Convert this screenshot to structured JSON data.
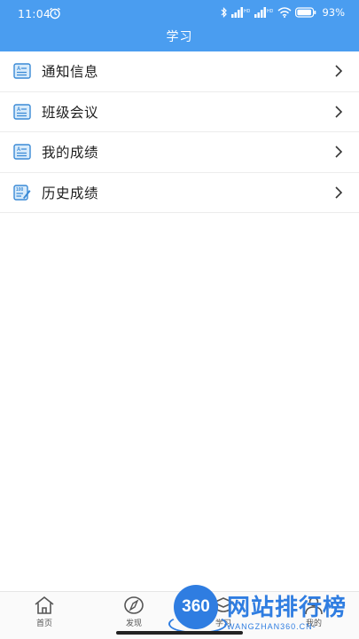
{
  "status_bar": {
    "time": "11:04",
    "battery": "93%"
  },
  "header": {
    "title": "学习"
  },
  "menu": {
    "items": [
      {
        "label": "通知信息",
        "icon": "notice-doc-icon"
      },
      {
        "label": "班级会议",
        "icon": "meeting-doc-icon"
      },
      {
        "label": "我的成绩",
        "icon": "score-doc-icon"
      },
      {
        "label": "历史成绩",
        "icon": "history-score-icon"
      }
    ]
  },
  "tabbar": {
    "items": [
      {
        "label": "首页",
        "icon": "home-icon"
      },
      {
        "label": "发现",
        "icon": "compass-icon"
      },
      {
        "label": "学习",
        "icon": "graduation-cap-icon"
      },
      {
        "label": "我的",
        "icon": "person-icon"
      }
    ]
  },
  "watermark": {
    "badge": "360",
    "text": "网站排行榜",
    "subtext": "-WANGZHAN360.CN-"
  },
  "colors": {
    "header": "#4a9df0",
    "icon": "#3a8ad6",
    "watermark": "#2f7de1"
  }
}
